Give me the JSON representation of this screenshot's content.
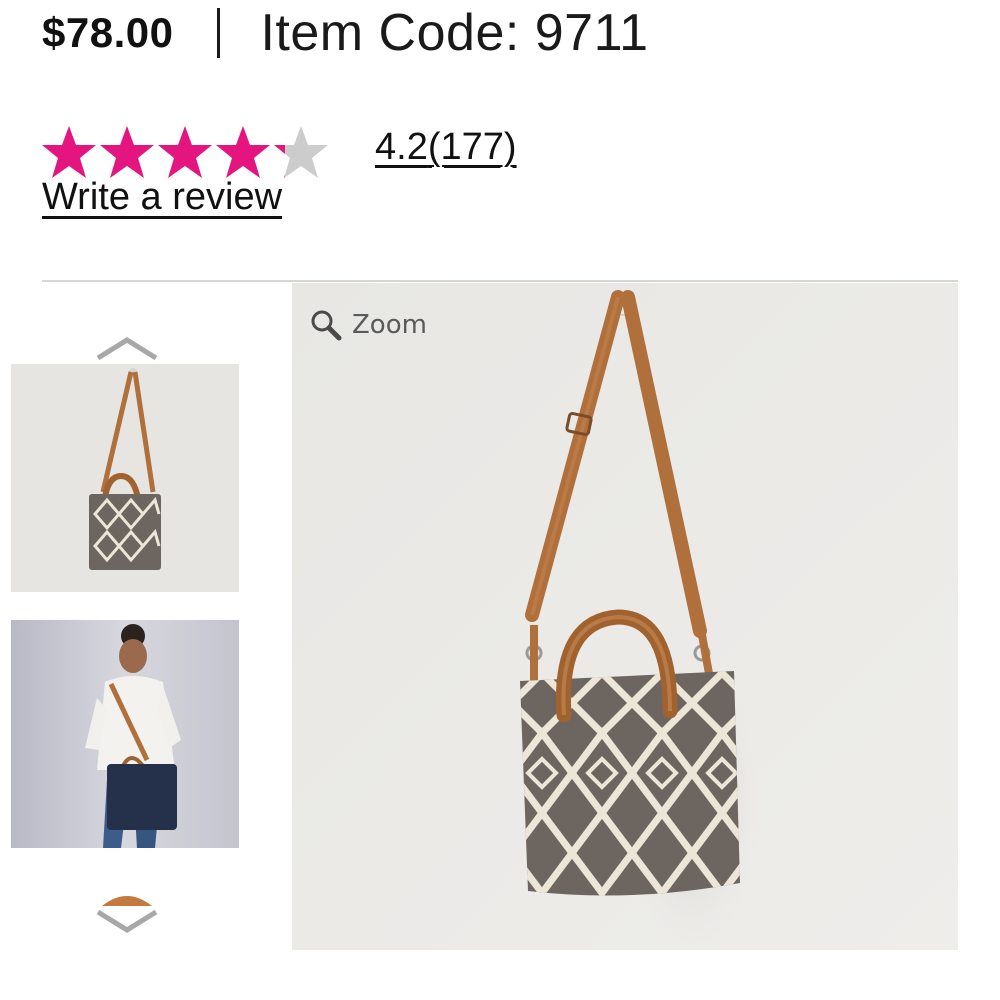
{
  "product": {
    "price": "$78.00",
    "item_code_label": "Item Code: 9711"
  },
  "rating": {
    "value": 4.2,
    "max": 5,
    "score_text": "4.2",
    "count_text": "(177)",
    "write_review": "Write a review",
    "star_color": "#e5157f",
    "empty_star_color": "#cccccc"
  },
  "gallery": {
    "zoom_label": "Zoom",
    "thumbnails": [
      {
        "icon": "bag-hanging-photo",
        "selected": true
      },
      {
        "icon": "model-with-navy-bag-photo",
        "selected": false
      }
    ],
    "up_arrow_icon": "chevron-up-icon",
    "down_arrow_icon": "chevron-down-icon"
  },
  "colors": {
    "leather": "#b0703c",
    "bag_body": "#6d6660",
    "pattern": "#ece6d8",
    "image_bg": "#e9e8e5"
  }
}
